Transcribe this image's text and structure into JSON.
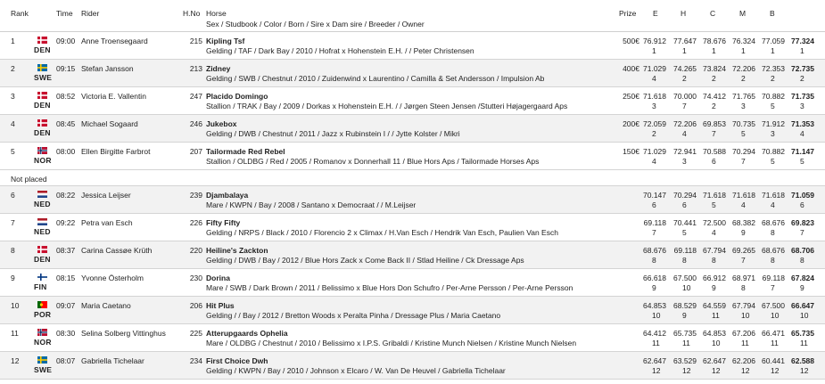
{
  "header": {
    "rank": "Rank",
    "time": "Time",
    "rider": "Rider",
    "hno": "H.No",
    "horse": "Horse",
    "horse_sub": "Sex / Studbook / Color / Born / Sire x Dam sire / Breeder / Owner",
    "prize": "Prize",
    "judges": [
      "E",
      "H",
      "C",
      "M",
      "B"
    ]
  },
  "not_placed_label": "Not placed",
  "rows": [
    {
      "rank": "1",
      "country": "DEN",
      "flag": "den",
      "time": "09:00",
      "rider": "Anne Troensegaard",
      "hno": "215",
      "horse": "Kipling Tsf",
      "details": "Gelding / TAF / Dark Bay / 2010 / Hofrat x Hohenstein E.H. / / Peter Christensen",
      "prize": "500€",
      "scores": [
        "76.912",
        "77.647",
        "78.676",
        "76.324",
        "77.059",
        "77.324"
      ],
      "ranks": [
        "1",
        "1",
        "1",
        "1",
        "1",
        "1"
      ]
    },
    {
      "rank": "2",
      "country": "SWE",
      "flag": "swe",
      "time": "09:15",
      "rider": "Stefan Jansson",
      "hno": "213",
      "horse": "Zidney",
      "details": "Gelding / SWB / Chestnut / 2010 / Zuidenwind x Laurentino / Camilla & Set Andersson / Impulsion Ab",
      "prize": "400€",
      "scores": [
        "71.029",
        "74.265",
        "73.824",
        "72.206",
        "72.353",
        "72.735"
      ],
      "ranks": [
        "4",
        "2",
        "2",
        "2",
        "2",
        "2"
      ]
    },
    {
      "rank": "3",
      "country": "DEN",
      "flag": "den",
      "time": "08:52",
      "rider": "Victoria E. Vallentin",
      "hno": "247",
      "horse": "Placido Domingo",
      "details": "Stallion / TRAK / Bay / 2009 / Dorkas x Hohenstein E.H. / / Jørgen Steen Jensen /Stutteri Højagergaard Aps",
      "prize": "250€",
      "scores": [
        "71.618",
        "70.000",
        "74.412",
        "71.765",
        "70.882",
        "71.735"
      ],
      "ranks": [
        "3",
        "7",
        "2",
        "3",
        "5",
        "3"
      ]
    },
    {
      "rank": "4",
      "country": "DEN",
      "flag": "den",
      "time": "08:45",
      "rider": "Michael Sogaard",
      "hno": "246",
      "horse": "Jukebox",
      "details": "Gelding / DWB / Chestnut / 2011 / Jazz x Rubinstein I / / Jytte Kolster / Mikri",
      "prize": "200€",
      "scores": [
        "72.059",
        "72.206",
        "69.853",
        "70.735",
        "71.912",
        "71.353"
      ],
      "ranks": [
        "2",
        "4",
        "7",
        "5",
        "3",
        "4"
      ]
    },
    {
      "rank": "5",
      "country": "NOR",
      "flag": "nor",
      "time": "08:00",
      "rider": "Ellen Birgitte Farbrot",
      "hno": "207",
      "horse": "Tailormade Red Rebel",
      "details": "Stallion / OLDBG / Red / 2005 / Romanov x Donnerhall 11 / Blue Hors Aps / Tailormade Horses Aps",
      "prize": "150€",
      "scores": [
        "71.029",
        "72.941",
        "70.588",
        "70.294",
        "70.882",
        "71.147"
      ],
      "ranks": [
        "4",
        "3",
        "6",
        "7",
        "5",
        "5"
      ]
    },
    {
      "rank": "6",
      "country": "NED",
      "flag": "ned",
      "time": "08:22",
      "rider": "Jessica Leijser",
      "hno": "239",
      "horse": "Djambalaya",
      "details": "Mare / KWPN / Bay / 2008 / Santano x Democraat / / M.Leijser",
      "prize": "",
      "scores": [
        "70.147",
        "70.294",
        "71.618",
        "71.618",
        "71.618",
        "71.059"
      ],
      "ranks": [
        "6",
        "6",
        "5",
        "4",
        "4",
        "6"
      ]
    },
    {
      "rank": "7",
      "country": "NED",
      "flag": "ned",
      "time": "09:22",
      "rider": "Petra van Esch",
      "hno": "226",
      "horse": "Fifty Fifty",
      "details": "Gelding / NRPS / Black / 2010 / Florencio 2 x Climax / H.Van Esch / Hendrik Van Esch, Paulien Van Esch",
      "prize": "",
      "scores": [
        "69.118",
        "70.441",
        "72.500",
        "68.382",
        "68.676",
        "69.823"
      ],
      "ranks": [
        "7",
        "5",
        "4",
        "9",
        "8",
        "7"
      ]
    },
    {
      "rank": "8",
      "country": "DEN",
      "flag": "den",
      "time": "08:37",
      "rider": "Carina Cassøe Krüth",
      "hno": "220",
      "horse": "Heiline's Zackton",
      "details": "Gelding / DWB / Bay / 2012 / Blue Hors Zack x Come Back II / Stlad Heiline / Ck Dressage Aps",
      "prize": "",
      "scores": [
        "68.676",
        "69.118",
        "67.794",
        "69.265",
        "68.676",
        "68.706"
      ],
      "ranks": [
        "8",
        "8",
        "8",
        "7",
        "8",
        "8"
      ]
    },
    {
      "rank": "9",
      "country": "FIN",
      "flag": "fin",
      "time": "08:15",
      "rider": "Yvonne Österholm",
      "hno": "230",
      "horse": "Dorina",
      "details": "Mare / SWB / Dark Brown / 2011 / Belissimo x Blue Hors Don Schufro / Per-Arne Persson / Per-Arne Persson",
      "prize": "",
      "scores": [
        "66.618",
        "67.500",
        "66.912",
        "68.971",
        "69.118",
        "67.824"
      ],
      "ranks": [
        "9",
        "10",
        "9",
        "8",
        "7",
        "9"
      ]
    },
    {
      "rank": "10",
      "country": "POR",
      "flag": "por",
      "time": "09:07",
      "rider": "Maria Caetano",
      "hno": "206",
      "horse": "Hit Plus",
      "details": "Gelding / / Bay / 2012 / Bretton Woods x Peralta Pinha / Dressage Plus / Maria Caetano",
      "prize": "",
      "scores": [
        "64.853",
        "68.529",
        "64.559",
        "67.794",
        "67.500",
        "66.647"
      ],
      "ranks": [
        "10",
        "9",
        "11",
        "10",
        "10",
        "10"
      ]
    },
    {
      "rank": "11",
      "country": "NOR",
      "flag": "nor",
      "time": "08:30",
      "rider": "Selina Solberg Vittinghus",
      "hno": "225",
      "horse": "Atterupgaards Ophelia",
      "details": "Mare / OLDBG / Chestnut / 2010 / Belissimo x I.P.S. Gribaldi / Kristine Munch Nielsen / Kristine Munch Nielsen",
      "prize": "",
      "scores": [
        "64.412",
        "65.735",
        "64.853",
        "67.206",
        "66.471",
        "65.735"
      ],
      "ranks": [
        "11",
        "11",
        "10",
        "11",
        "11",
        "11"
      ]
    },
    {
      "rank": "12",
      "country": "SWE",
      "flag": "swe",
      "time": "08:07",
      "rider": "Gabriella Tichelaar",
      "hno": "234",
      "horse": "First Choice Dwh",
      "details": "Gelding / KWPN / Bay / 2010 / Johnson x Elcaro / W. Van De Heuvel / Gabriella Tichelaar",
      "prize": "",
      "scores": [
        "62.647",
        "63.529",
        "62.647",
        "62.206",
        "60.441",
        "62.588"
      ],
      "ranks": [
        "12",
        "12",
        "12",
        "12",
        "12",
        "12"
      ]
    }
  ]
}
